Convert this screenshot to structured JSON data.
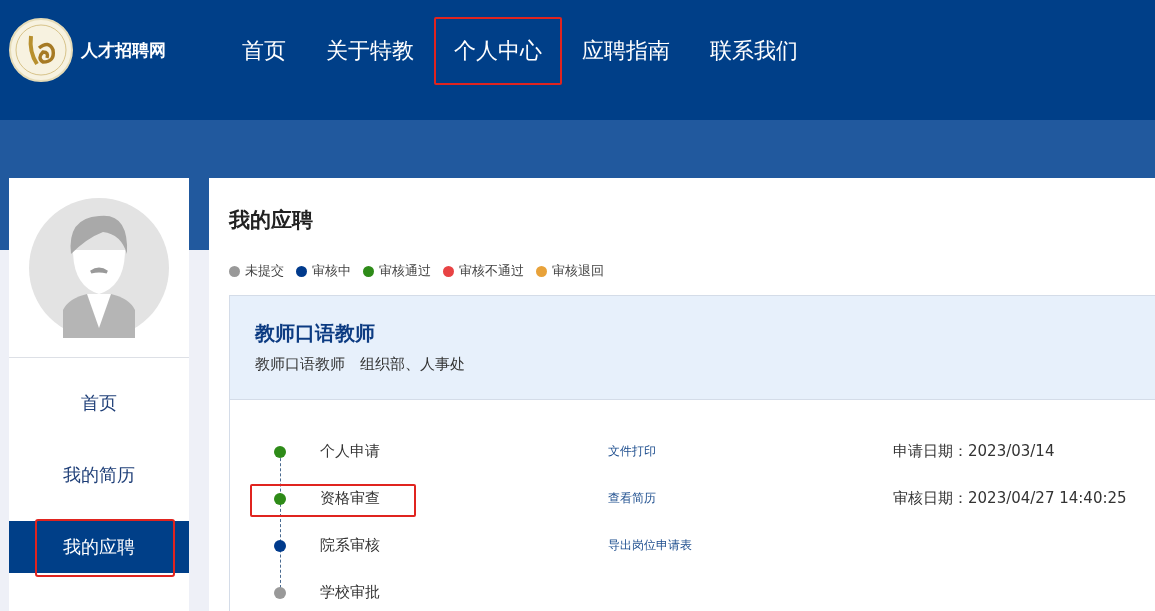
{
  "header": {
    "site_name": "人才招聘网",
    "nav": [
      {
        "label": "首页",
        "highlighted": false
      },
      {
        "label": "关于特教",
        "highlighted": false
      },
      {
        "label": "个人中心",
        "highlighted": true
      },
      {
        "label": "应聘指南",
        "highlighted": false
      },
      {
        "label": "联系我们",
        "highlighted": false
      }
    ]
  },
  "sidebar": {
    "items": [
      {
        "label": "首页",
        "selected": false,
        "highlighted": false
      },
      {
        "label": "我的简历",
        "selected": false,
        "highlighted": false
      },
      {
        "label": "我的应聘",
        "selected": true,
        "highlighted": true
      }
    ]
  },
  "main": {
    "title": "我的应聘",
    "legend": [
      {
        "label": "未提交",
        "color": "#999999"
      },
      {
        "label": "审核中",
        "color": "#003a8c"
      },
      {
        "label": "审核通过",
        "color": "#2e8b18"
      },
      {
        "label": "审核不通过",
        "color": "#e84344"
      },
      {
        "label": "审核退回",
        "color": "#e8a23a"
      }
    ],
    "application": {
      "position": "教师口语教师",
      "subtitle": "教师口语教师　组织部、人事处",
      "steps": [
        {
          "name": "个人申请",
          "color": "#2e8b18",
          "link": "文件打印",
          "date": "申请日期：2023/03/14",
          "highlighted": false
        },
        {
          "name": "资格审查",
          "color": "#2e8b18",
          "link": "查看简历",
          "date": "审核日期：2023/04/27 14:40:25",
          "highlighted": true
        },
        {
          "name": "院系审核",
          "color": "#003a8c",
          "link": "导出岗位申请表",
          "highlighted": false
        },
        {
          "name": "学校审批",
          "color": "#999999",
          "highlighted": false
        }
      ]
    }
  }
}
